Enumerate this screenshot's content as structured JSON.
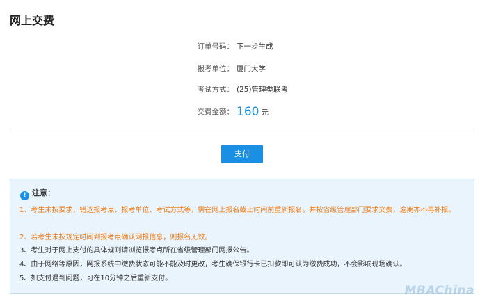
{
  "page": {
    "title": "网上交费"
  },
  "order": {
    "number_label": "订单号码：",
    "number_value": "下一步生成",
    "unit_label": "报考单位：",
    "unit_value": "厦门大学",
    "mode_label": "考试方式：",
    "mode_value": "(25)管理类联考",
    "amount_label": "交费金额：",
    "amount_value": "160",
    "amount_unit": "元"
  },
  "actions": {
    "pay_label": "支付"
  },
  "notice": {
    "icon": "info-icon",
    "icon_glyph": "!",
    "title": "注意：",
    "items": [
      "1、考生未按要求，错选报考点、报考单位、考试方式等，需在网上报名截止时间前重新报名，并按省级管理部门要求交费，逾期亦不再补报。",
      "2、若考生未按规定时间到报考点确认网报信息，则报名无效。",
      "3、考生对于网上支付的具体规则请浏览报考点所在省级管理部门网报公告。",
      "4、由于网络等原因，网报系统中缴费状态可能不能及时更改，考生确保银行卡已扣款即可认为缴费成功，不会影响现场确认。",
      "5、如支付遇到问题，可在10分钟之后重新支付。"
    ]
  },
  "watermark": "MBAChina",
  "colors": {
    "accent": "#1a8fe3",
    "warning": "#f07a12",
    "notice_bg": "#e9f4fc",
    "notice_border": "#bcdaf0"
  }
}
